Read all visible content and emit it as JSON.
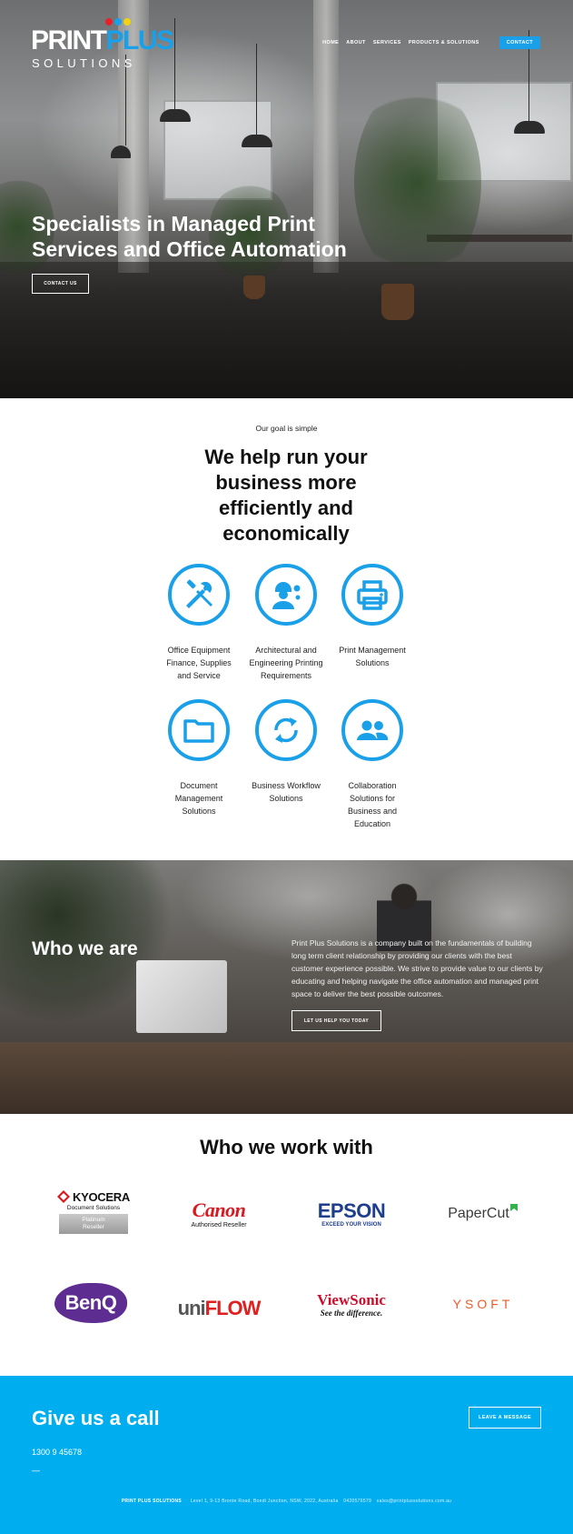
{
  "logo": {
    "primary": "PRINT",
    "accent": "PLUS",
    "sub": "SOLUTIONS",
    "dot_colors": [
      "#e8202a",
      "#1aa0e8",
      "#f4d20c"
    ]
  },
  "nav": {
    "items": [
      "HOME",
      "ABOUT",
      "SERVICES",
      "PRODUCTS & SOLUTIONS"
    ],
    "contact": "CONTACT"
  },
  "hero": {
    "title": "Specialists in Managed Print Services and Office Automation",
    "button": "CONTACT US"
  },
  "goal": {
    "kicker": "Our goal is simple",
    "headline_lines": [
      "We help run your",
      "business more",
      "efficiently and",
      "economically"
    ],
    "services": [
      {
        "icon": "tools-icon",
        "label_lines": [
          "Office Equipment",
          "Finance, Supplies",
          "and Service"
        ]
      },
      {
        "icon": "engineer-icon",
        "label_lines": [
          "Architectural and",
          "Engineering Printing",
          "Requirements"
        ]
      },
      {
        "icon": "printer-icon",
        "label_lines": [
          "Print Management",
          "Solutions"
        ]
      },
      {
        "icon": "folder-icon",
        "label_lines": [
          "Document",
          "Management",
          "Solutions"
        ]
      },
      {
        "icon": "sync-icon",
        "label_lines": [
          "Business Workflow",
          "Solutions"
        ]
      },
      {
        "icon": "group-icon",
        "label_lines": [
          "Collaboration",
          "Solutions for",
          "Business and",
          "Education"
        ]
      }
    ]
  },
  "who": {
    "title": "Who we are",
    "text": "Print Plus Solutions is a company built on the fundamentals of building long term client relationship by providing our clients with the best customer experience possible. We strive to provide value to our clients by educating and helping navigate the office automation and managed print space to deliver the best possible outcomes.",
    "button": "LET US HELP YOU TODAY"
  },
  "partners": {
    "title": "Who we work with",
    "kyocera": {
      "name": "KYOCERA",
      "sub": "Document Solutions",
      "badge_line1": "Platinum",
      "badge_line2": "Reseller"
    },
    "canon": {
      "name": "Canon",
      "sub": "Authorised Reseller"
    },
    "epson": {
      "name": "EPSON",
      "sub": "EXCEED YOUR VISION"
    },
    "papercut": {
      "name": "PaperCut"
    },
    "benq": {
      "name": "BenQ"
    },
    "uniflow": {
      "uni": "uni",
      "flow": "FLOW"
    },
    "viewsonic": {
      "name": "ViewSonic",
      "sub": "See the difference."
    },
    "ysoft": {
      "name": "YSOFT"
    }
  },
  "call": {
    "title": "Give us a call",
    "phone": "1300 9 45678",
    "dash": "—",
    "button": "LEAVE A MESSAGE"
  },
  "footer": {
    "company": "PRINT PLUS SOLUTIONS",
    "address": "Level 1, 9-13 Bronte Road, Bondi Junction, NSW, 2022, Australia",
    "mobile": "0420576579",
    "email": "sales@printplussolutions.com.au"
  },
  "colors": {
    "accent": "#1aa0e8",
    "call_bg": "#00aeef"
  }
}
